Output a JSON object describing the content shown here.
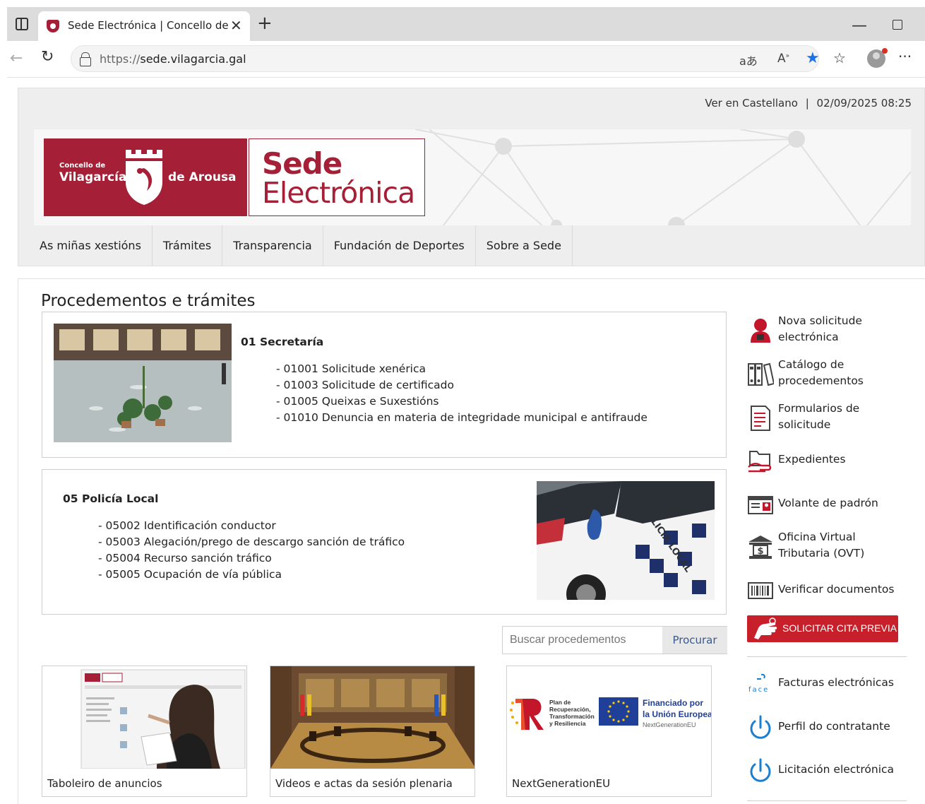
{
  "browser": {
    "tab_title": "Sede Electrónica | Concello de Vilagarcía",
    "url_scheme": "https://",
    "url_host": "sede.vilagarcia.gal",
    "read_aloud_glyph": "aあ",
    "text_size_glyph": "A̧",
    "more_glyph": "···"
  },
  "topline": {
    "language_link": "Ver en Castellano",
    "separator": "|",
    "datetime": "02/09/2025 08:25"
  },
  "logo": {
    "concello": "Concello de",
    "vilagarcia": "Vilagarcía",
    "de_arousa": "de Arousa",
    "sede_line1": "Sede",
    "sede_line2": "Electrónica"
  },
  "nav": [
    "As miñas xestións",
    "Trámites",
    "Transparencia",
    "Fundación de Deportes",
    "Sobre a Sede"
  ],
  "main": {
    "heading": "Procedementos e trámites",
    "panels": [
      {
        "title": "01 Secretaría",
        "items": [
          "- 01001 Solicitude xenérica",
          "- 01003 Solicitude de certificado",
          "- 01005 Queixas e Suxestións",
          "- 01010 Denuncia en materia de integridade municipal e antifraude"
        ]
      },
      {
        "title": "05 Policía Local",
        "items": [
          "- 05002 Identificación conductor",
          "- 05003 Alegación/prego de descargo sanción de tráfico",
          "- 05004 Recurso sanción tráfico",
          "- 05005 Ocupación de vía pública"
        ]
      }
    ],
    "search": {
      "placeholder": "Buscar procedementos",
      "button": "Procurar"
    },
    "cards": [
      "Taboleiro de anuncios",
      "Videos e actas da sesión plenaria",
      "NextGenerationEU"
    ],
    "eu_logo": {
      "plan_text": "Plan de\nRecuperación,\nTransformación\ny Resiliencia",
      "funded_1": "Financiado por",
      "funded_2": "la Unión Europea",
      "ngeu": "NextGenerationEU"
    }
  },
  "sidebar": {
    "items": [
      {
        "label": "Nova solicitude electrónica",
        "icon": "person-icon"
      },
      {
        "label": "Catálogo de procedementos",
        "icon": "binders-icon"
      },
      {
        "label": "Formularios de solicitude",
        "icon": "form-icon"
      },
      {
        "label": "Expedientes",
        "icon": "folder-hand-icon"
      },
      {
        "label": "Volante de padrón",
        "icon": "id-card-icon"
      },
      {
        "label": "Oficina Virtual Tributaria (OVT)",
        "icon": "bank-icon"
      },
      {
        "label": "Verificar documentos",
        "icon": "barcode-icon"
      }
    ],
    "cita_previa": "SOLICITAR CITA PREVIA",
    "lower_items": [
      {
        "label": "Facturas electrónicas",
        "icon": "face-icon"
      },
      {
        "label": "Perfil do contratante",
        "icon": "power-icon"
      },
      {
        "label": "Licitación electrónica",
        "icon": "power-icon"
      }
    ],
    "face_text": "face"
  },
  "colors": {
    "brand_red": "#a51f36",
    "cita_red": "#c7202b",
    "power_blue": "#1a7fd1",
    "link_blue": "#3a5a8c"
  }
}
